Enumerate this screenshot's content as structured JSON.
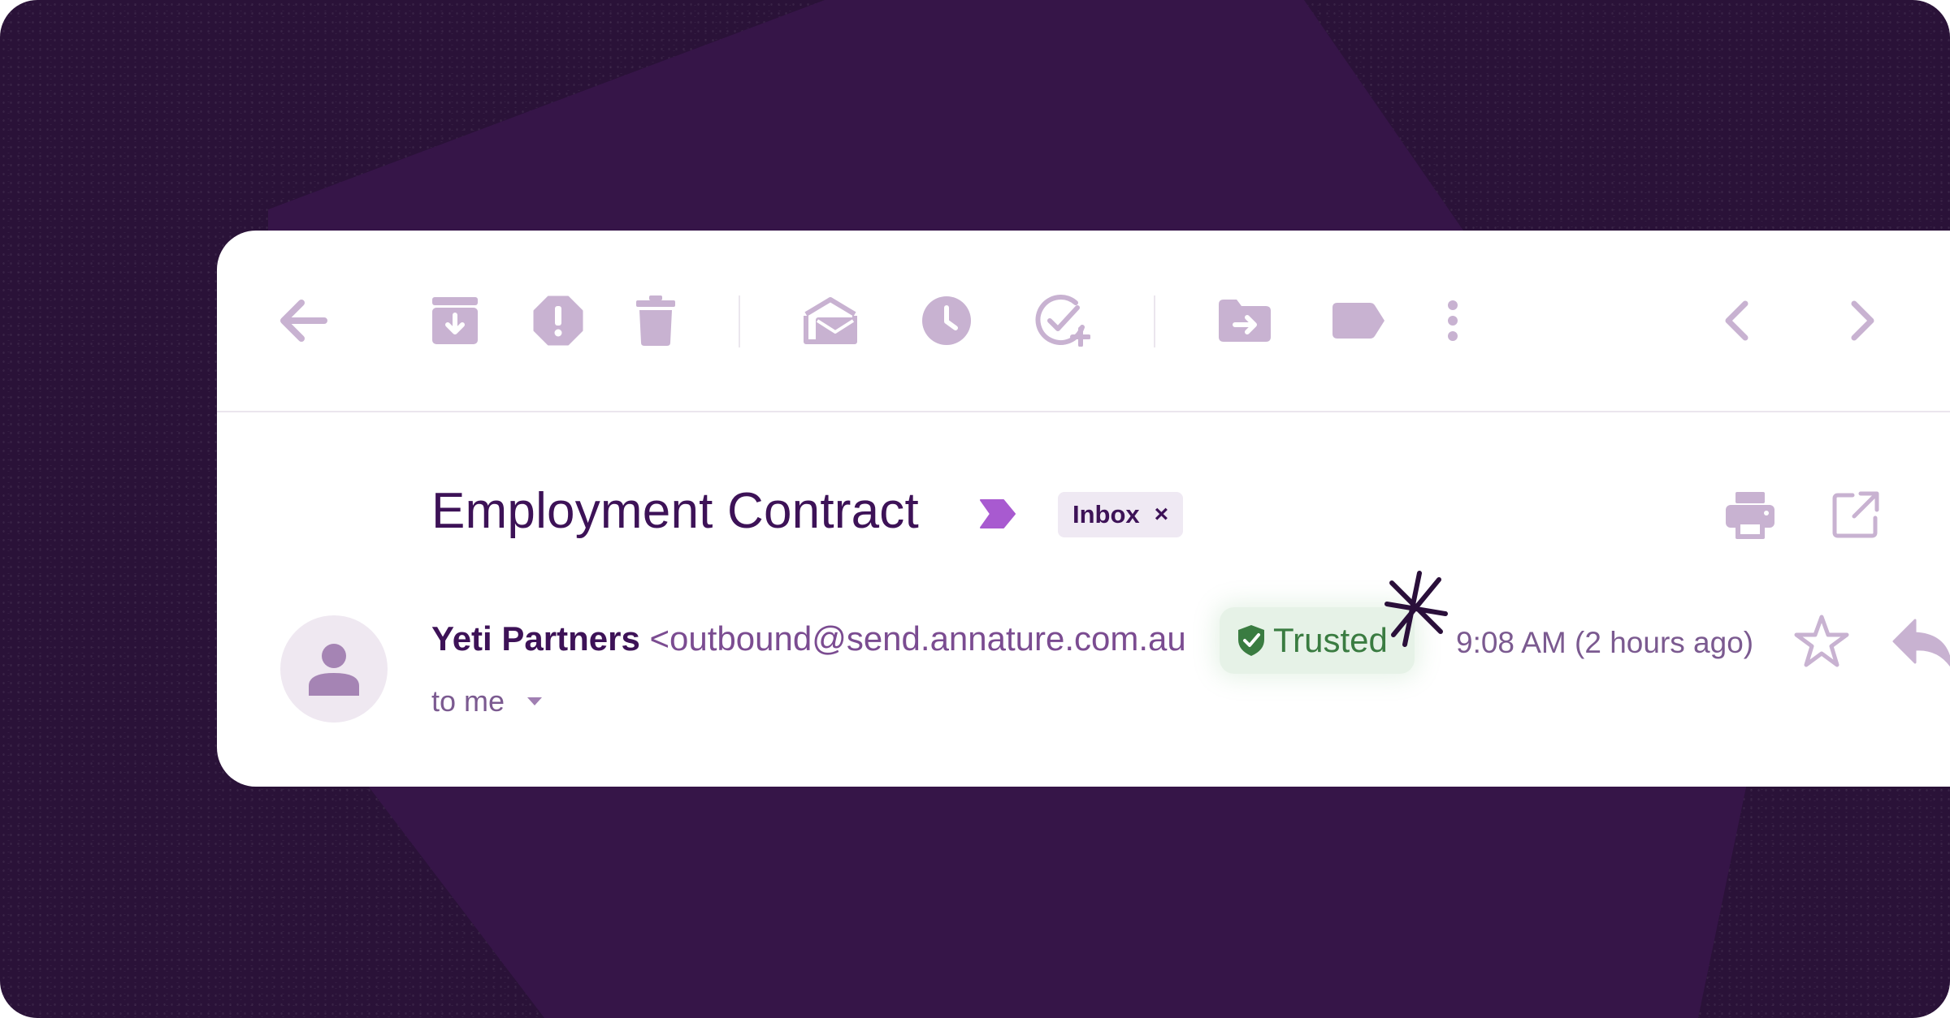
{
  "email": {
    "subject": "Employment Contract",
    "label_chip": {
      "text": "Inbox",
      "remove": "×"
    },
    "sender_name": "Yeti Partners",
    "sender_email": "<outbound@send.annature.com.au",
    "trust_badge": "Trusted",
    "timestamp": "9:08 AM (2 hours ago)",
    "recipient": "to me"
  },
  "toolbar": {
    "icons": [
      "back-arrow-icon",
      "archive-icon",
      "report-spam-icon",
      "delete-icon",
      "mark-unread-icon",
      "snooze-icon",
      "add-to-tasks-icon",
      "move-to-icon",
      "label-icon",
      "more-options-icon",
      "newer-icon",
      "older-icon"
    ]
  },
  "colors": {
    "background": "#2a1238",
    "accent": "#3d1257",
    "icon": "#c8b2d1",
    "trusted_green": "#3a7c41",
    "label_arrow": "#a85ad0"
  }
}
